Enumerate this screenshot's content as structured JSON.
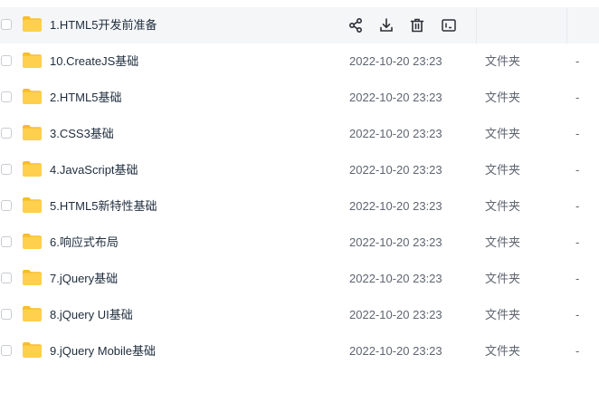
{
  "icons": {
    "folder": "folder-icon",
    "share": "share-icon",
    "download": "download-icon",
    "delete": "trash-icon",
    "more": "info-panel-icon"
  },
  "colors": {
    "folder": "#ffcc3d",
    "hover_row": "#f5f6f8",
    "text": "#1f2d3d",
    "muted": "#5f6570"
  },
  "rows": [
    {
      "name": "1.HTML5开发前准备",
      "date": "",
      "type": "",
      "size": "",
      "hover": true
    },
    {
      "name": "10.CreateJS基础",
      "date": "2022-10-20 23:23",
      "type": "文件夹",
      "size": "-"
    },
    {
      "name": "2.HTML5基础",
      "date": "2022-10-20 23:23",
      "type": "文件夹",
      "size": "-"
    },
    {
      "name": "3.CSS3基础",
      "date": "2022-10-20 23:23",
      "type": "文件夹",
      "size": "-"
    },
    {
      "name": "4.JavaScript基础",
      "date": "2022-10-20 23:23",
      "type": "文件夹",
      "size": "-"
    },
    {
      "name": "5.HTML5新特性基础",
      "date": "2022-10-20 23:23",
      "type": "文件夹",
      "size": "-"
    },
    {
      "name": "6.响应式布局",
      "date": "2022-10-20 23:23",
      "type": "文件夹",
      "size": "-"
    },
    {
      "name": "7.jQuery基础",
      "date": "2022-10-20 23:23",
      "type": "文件夹",
      "size": "-"
    },
    {
      "name": "8.jQuery UI基础",
      "date": "2022-10-20 23:23",
      "type": "文件夹",
      "size": "-"
    },
    {
      "name": "9.jQuery Mobile基础",
      "date": "2022-10-20 23:23",
      "type": "文件夹",
      "size": "-"
    }
  ]
}
